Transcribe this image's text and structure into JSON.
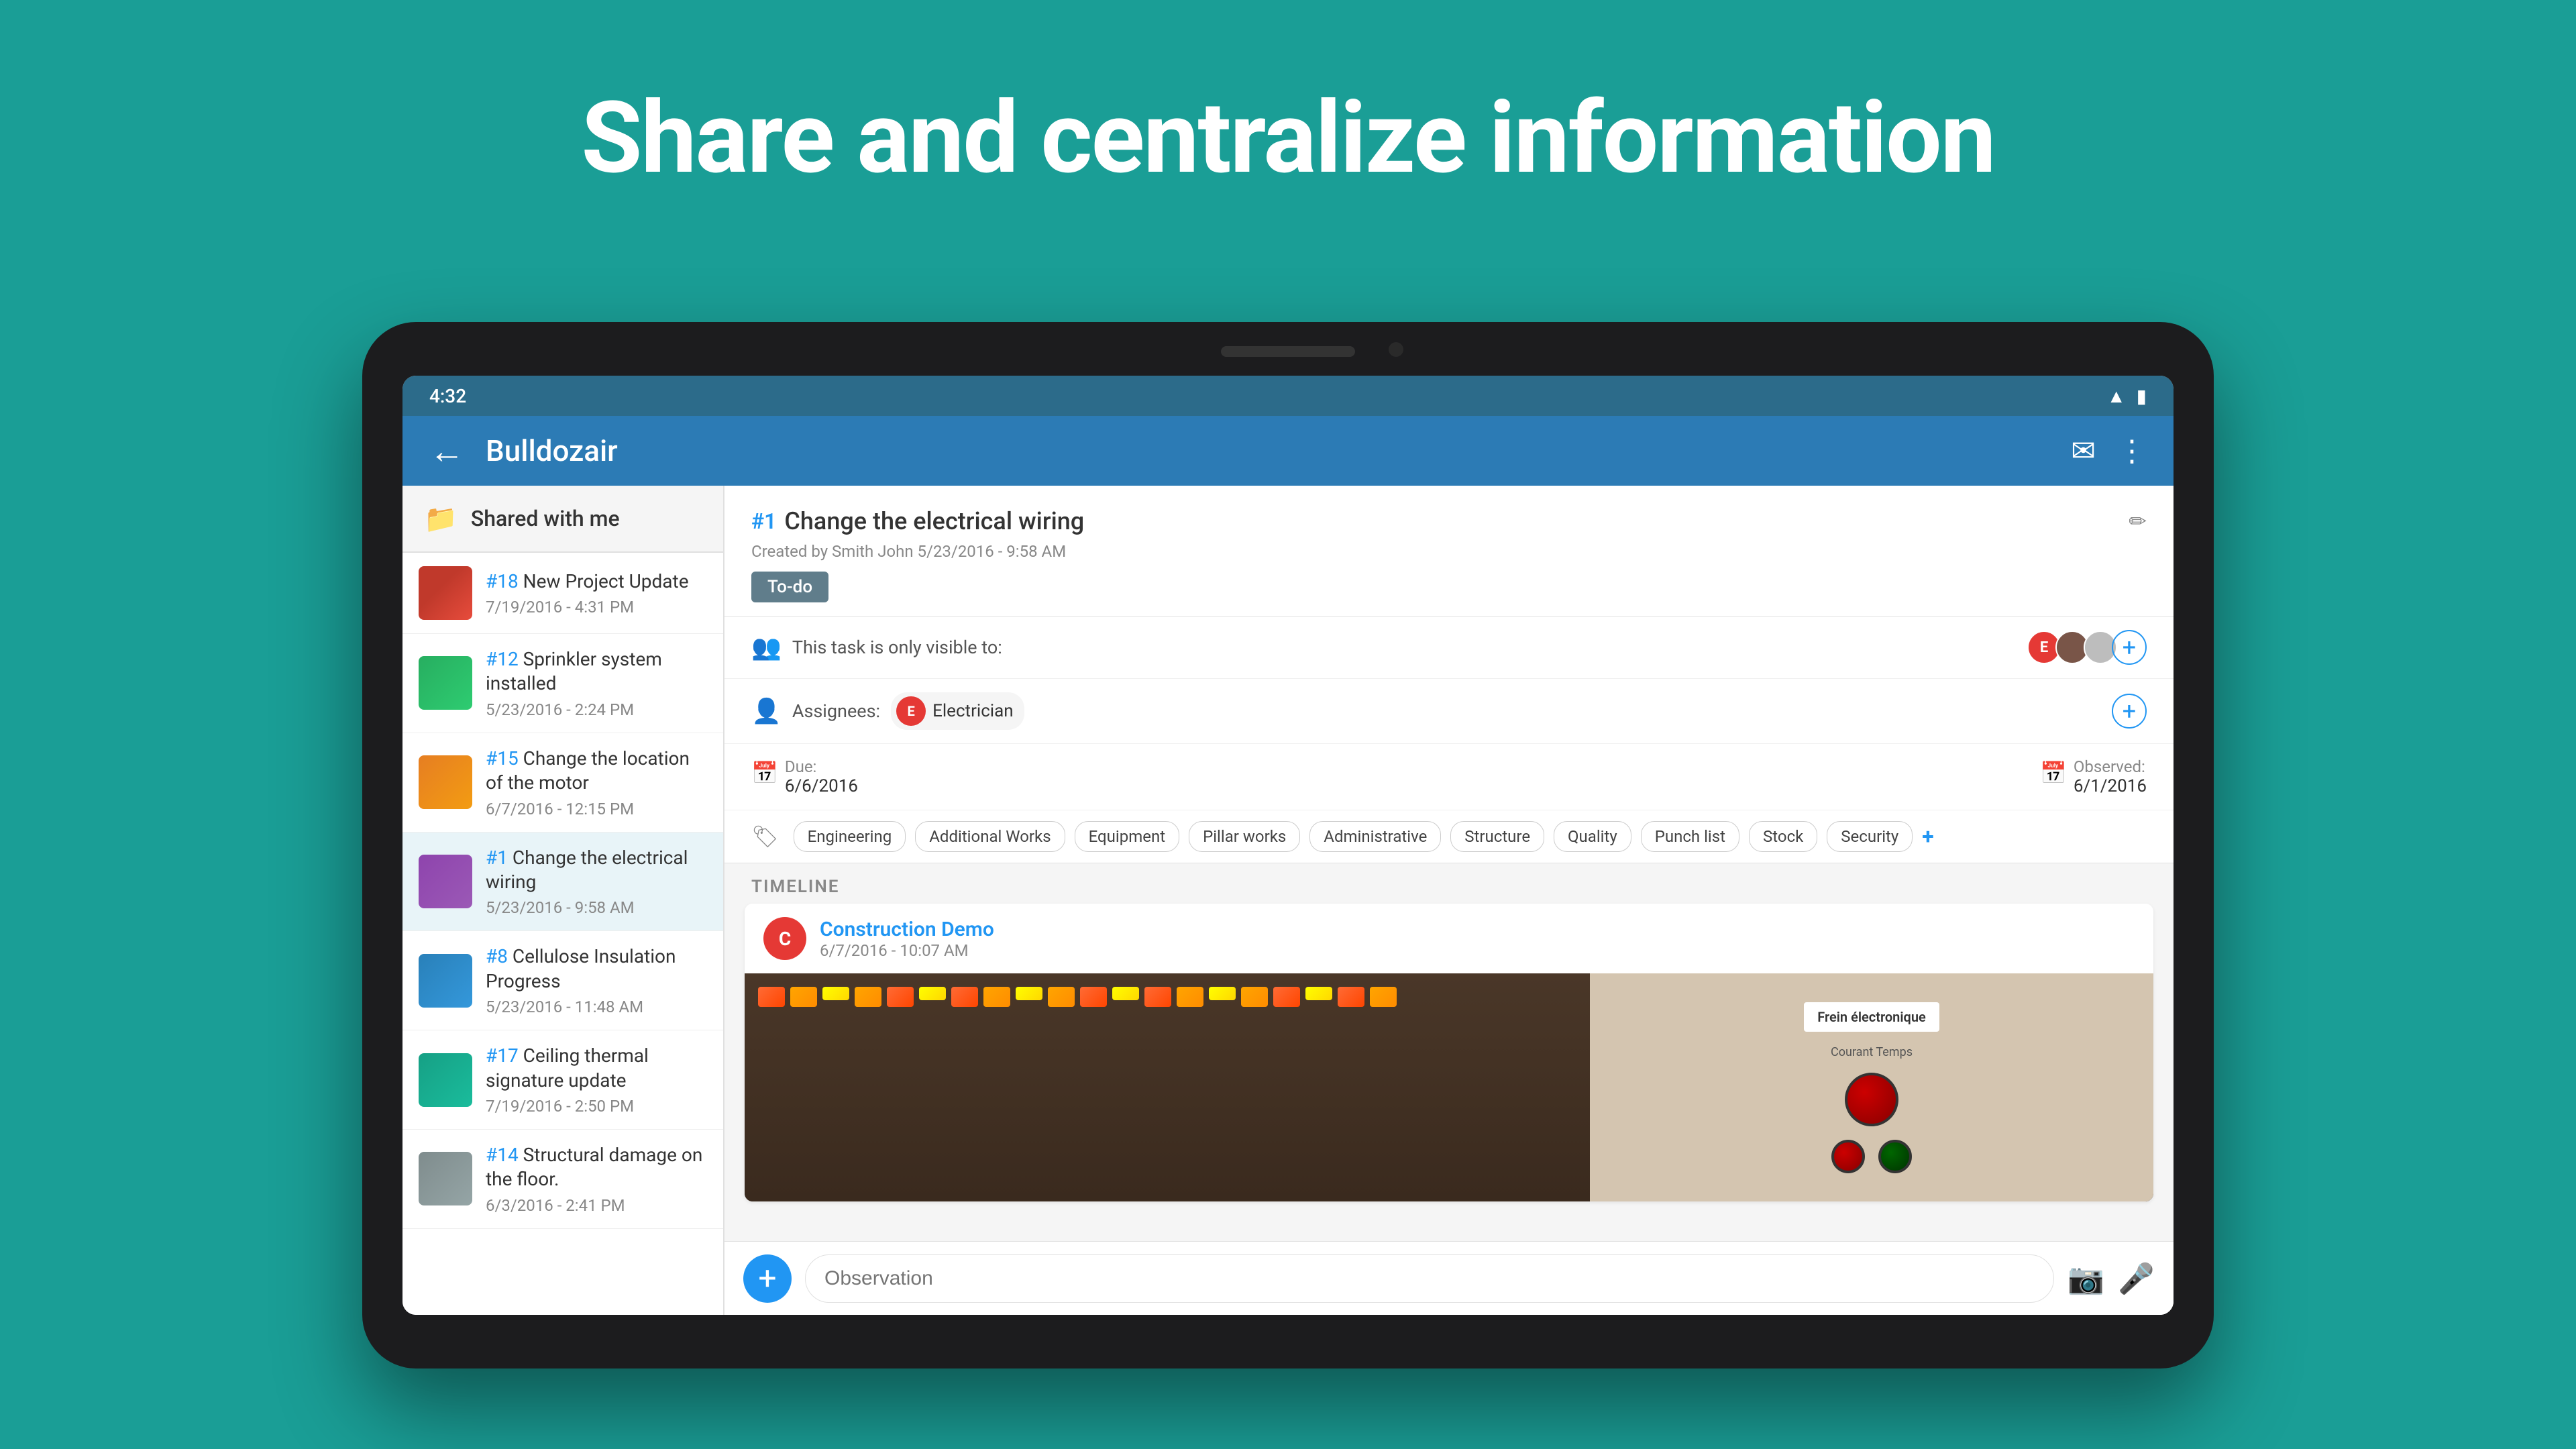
{
  "background": {
    "color": "#1a9e96"
  },
  "hero": {
    "title": "Share and centralize information"
  },
  "tablet": {
    "status_bar": {
      "time": "4:32",
      "wifi_icon": "wifi",
      "battery_icon": "battery"
    },
    "app_bar": {
      "title": "Bulldozair",
      "back_icon": "←",
      "email_icon": "✉",
      "more_icon": "⋮"
    },
    "sidebar": {
      "header": "Shared with me",
      "items": [
        {
          "number": "#18",
          "title": "New Project Update",
          "date": "7/19/2016 - 4:31 PM",
          "thumb_type": "project"
        },
        {
          "number": "#12",
          "title": "Sprinkler system installed",
          "date": "5/23/2016 - 2:24 PM",
          "thumb_type": "sprinkler"
        },
        {
          "number": "#15",
          "title": "Change the location of the motor",
          "date": "6/7/2016 - 12:15 PM",
          "thumb_type": "motor"
        },
        {
          "number": "#1",
          "title": "Change the electrical wiring",
          "date": "5/23/2016 - 9:58 AM",
          "thumb_type": "wiring",
          "active": true
        },
        {
          "number": "#8",
          "title": "Cellulose Insulation Progress",
          "date": "5/23/2016 - 11:48 AM",
          "thumb_type": "cellulose"
        },
        {
          "number": "#17",
          "title": "Ceiling thermal signature update",
          "date": "7/19/2016 - 2:50 PM",
          "thumb_type": "ceiling"
        },
        {
          "number": "#14",
          "title": "Structural damage on the floor.",
          "date": "6/3/2016 - 2:41 PM",
          "thumb_type": "structural"
        }
      ]
    },
    "detail": {
      "number": "#1",
      "title": "Change the electrical wiring",
      "created": "Created by Smith John 5/23/2016 - 9:58 AM",
      "status": "To-do",
      "visibility_text": "This task is only visible to:",
      "assignees_label": "Assignees:",
      "assignee_name": "Electrician",
      "due_label": "Due:",
      "due_date": "6/6/2016",
      "observed_label": "Observed:",
      "observed_date": "6/1/2016",
      "tags": [
        "Engineering",
        "Additional Works",
        "Equipment",
        "Pillar works",
        "Administrative",
        "Structure",
        "Quality",
        "Punch list",
        "Stock",
        "Security"
      ],
      "timeline": {
        "label": "TIMELINE",
        "card": {
          "user_name": "Construction Demo",
          "date": "6/7/2016 - 10:07 AM"
        }
      }
    },
    "input_bar": {
      "placeholder": "Observation",
      "add_icon": "+",
      "camera_icon": "📷",
      "mic_icon": "🎤"
    }
  }
}
